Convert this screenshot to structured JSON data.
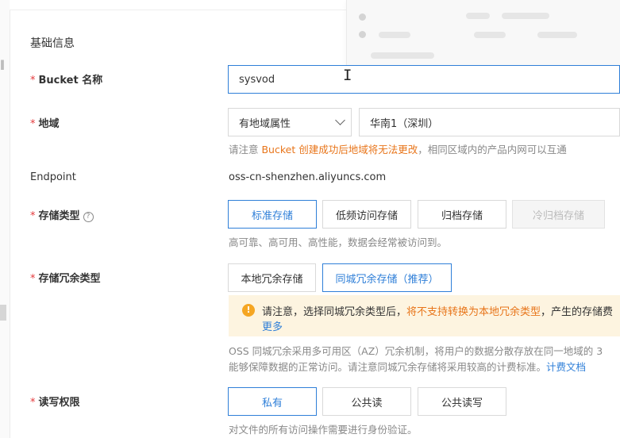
{
  "form": {
    "section_title": "基础信息",
    "required_mark": "*",
    "bucket_name": {
      "label": "Bucket 名称",
      "value": "sysvod"
    },
    "region": {
      "label": "地域",
      "attribute_select_value": "有地域属性",
      "region_select_value": "华南1（深圳）",
      "hint_prefix": "请注意 ",
      "hint_warning": "Bucket 创建成功后地域将无法更改",
      "hint_suffix": "，相同区域内的产品内网可以互通"
    },
    "endpoint": {
      "label": "Endpoint",
      "value": "oss-cn-shenzhen.aliyuncs.com"
    },
    "storage_class": {
      "label": "存储类型",
      "options": [
        "标准存储",
        "低频访问存储",
        "归档存储",
        "冷归档存储"
      ],
      "selected": "标准存储",
      "hint": "高可靠、高可用、高性能，数据会经常被访问到。"
    },
    "redundancy": {
      "label": "存储冗余类型",
      "options": [
        "本地冗余存储",
        "同城冗余存储（推荐）"
      ],
      "selected": "同城冗余存储（推荐）",
      "alert_prefix": "请注意，选择同城冗余类型后，",
      "alert_warning": "将不支持转换为本地冗余类型",
      "alert_suffix": "，产生的存储费",
      "alert_more": "更多",
      "desc_line1": "OSS 同城冗余采用多可用区（AZ）冗余机制，将用户的数据分散存放在同一地域的 3",
      "desc_line2_prefix": "能够保障数据的正常访问。请注意同城冗余存储将采用较高的计费标准。",
      "desc_line2_link": "计费文档"
    },
    "acl": {
      "label": "读写权限",
      "options": [
        "私有",
        "公共读",
        "公共读写"
      ],
      "selected": "私有",
      "hint": "对文件的所有访问操作需要进行身份验证。"
    }
  },
  "icons": {
    "help": "question-circle-icon",
    "alert": "warning-circle-icon",
    "select_arrow": "chevron-down-icon",
    "cursor": "text-cursor-icon"
  },
  "colors": {
    "accent": "#2f7fd8",
    "required": "#e4393c",
    "warning_text": "#e8751a",
    "alert_bg": "#fdf4e0",
    "alert_icon": "#f5a623"
  }
}
